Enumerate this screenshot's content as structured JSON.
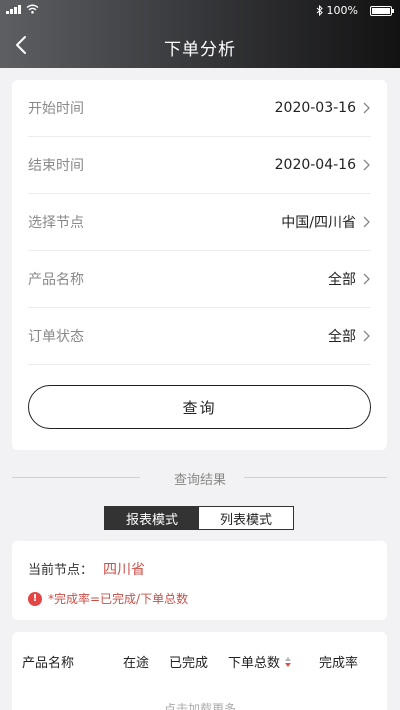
{
  "status_bar": {
    "battery": "100%"
  },
  "header": {
    "title": "下单分析"
  },
  "filters": [
    {
      "label": "开始时间",
      "value": "2020-03-16"
    },
    {
      "label": "结束时间",
      "value": "2020-04-16"
    },
    {
      "label": "选择节点",
      "value": "中国/四川省"
    },
    {
      "label": "产品名称",
      "value": "全部"
    },
    {
      "label": "订单状态",
      "value": "全部"
    }
  ],
  "query_button": "查询",
  "results_divider": "查询结果",
  "modes": {
    "report": "报表模式",
    "list": "列表模式",
    "active": "report"
  },
  "current_node": {
    "label": "当前节点：",
    "value": "四川省"
  },
  "note": "*完成率=已完成/下单总数",
  "table": {
    "columns": [
      "产品名称",
      "在途",
      "已完成",
      "下单总数",
      "完成率"
    ]
  },
  "load_more": "点击加载更多",
  "colors": {
    "accent_red": "#c9504a",
    "header_dark": "#121213"
  }
}
